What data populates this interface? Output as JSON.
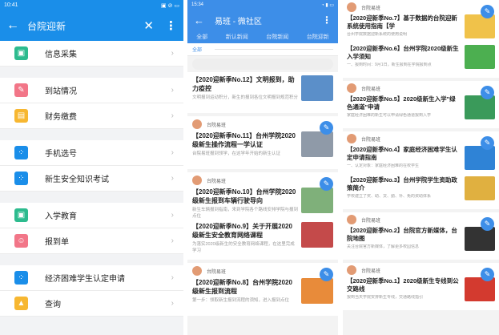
{
  "panel1": {
    "status_time": "10:41",
    "status_right": "▣ ⊘ ▭",
    "title": "台院迎新",
    "menu": [
      {
        "label": "信息采集",
        "icon": "image-icon",
        "glyph": "▣",
        "color": "#2dbb8e"
      },
      {
        "label": "到站情况",
        "icon": "edit-icon",
        "glyph": "✎",
        "color": "#f27688"
      },
      {
        "label": "财务缴费",
        "icon": "wallet-icon",
        "glyph": "▤",
        "color": "#f7b731"
      },
      {
        "label": "手机选号",
        "icon": "grid-icon",
        "glyph": "⁘",
        "color": "#1a8ee9"
      },
      {
        "label": "新生安全知识考试",
        "icon": "grid-icon",
        "glyph": "⁘",
        "color": "#1a8ee9"
      },
      {
        "label": "入学教育",
        "icon": "image-icon",
        "glyph": "▣",
        "color": "#2dbb8e"
      },
      {
        "label": "报到单",
        "icon": "person-icon",
        "glyph": "☺",
        "color": "#f27688"
      },
      {
        "label": "经济困难学生认定申请",
        "icon": "grid-icon",
        "glyph": "⁘",
        "color": "#1a8ee9"
      },
      {
        "label": "查询",
        "icon": "graduation-cap-icon",
        "glyph": "▲",
        "color": "#f7b731"
      }
    ]
  },
  "panel2": {
    "status_time": "15:34",
    "status_right": "◔ ▮ ▭",
    "title": "易班 - 微社区",
    "tabs": [
      "全部",
      "新认新闻",
      "台院新闻",
      "台院迎新"
    ],
    "subtab_active": "全部",
    "cards": [
      {
        "articles": [
          {
            "title": "【2020迎新季No.12】文明报到，助力疫控",
            "desc": "文明报到运动积分，新生的报到各位文明报到规范积分",
            "thumb": "#5b8fc9"
          }
        ]
      },
      {
        "account": "台院易班",
        "articles": [
          {
            "title": "【2020迎新季No.11】台州学院2020级新生操作流程一学认证",
            "desc": "台院易班报到领学，在这学年开始的新生认证",
            "thumb": "#8f9aa8"
          }
        ]
      },
      {
        "account": "台院易班",
        "articles": [
          {
            "title": "【2020迎新季No.10】台州学院2020级新生报到车辆行驶导向",
            "desc": "新生车辆报到指南，来到学院各个路线安排学院与报到点位",
            "thumb": "#7fb07a"
          },
          {
            "title": "【2020迎新季No.9】关于开展2020级新生安全教育网络课程",
            "desc": "为落实2020级新生的安全教育网络课程，在这里完成学习",
            "thumb": "#c44a4a"
          }
        ]
      },
      {
        "account": "台院易班",
        "articles": [
          {
            "title": "【2020迎新季No.8】台州学院2020级新生报到流程",
            "desc": "第一步：领取新生报到流程的须知，进入报到点位",
            "thumb": "#e88b3a"
          }
        ]
      }
    ]
  },
  "panel3": {
    "cards": [
      {
        "account": "台院易班",
        "articles": [
          {
            "title": "【2020迎新季No.7】基于数据的台院迎新系统使用指南【学",
            "desc": "台州学院数据迎新系统的使用说明",
            "thumb": "#f0c24a"
          },
          {
            "title": "【2020迎新季No.6】台州学院2020级新生入学须知",
            "desc": "一、报到时间：9月1日，新生报到在学院报到点",
            "thumb": "#4caf50"
          }
        ]
      },
      {
        "account": "台院易班",
        "articles": [
          {
            "title": "【2020迎新季No.5】2020级新生入学\"绿色通道\"申请",
            "desc": "家庭经济困难的新生可以申请绿色通道报到入学",
            "thumb": "#3a9a5a"
          }
        ]
      },
      {
        "account": "台院易班",
        "articles": [
          {
            "title": "【2020迎新季No.4】家庭经济困难学生认定申请指南",
            "desc": "一、认定对象：家庭经济困难的在校学生",
            "thumb": "#2f83d6"
          },
          {
            "title": "【2020迎新季No.3】台州学院学生资助政策简介",
            "desc": "学校建立了奖、助、贷、勤、补、免的资助体系",
            "thumb": "#e0b040"
          }
        ]
      },
      {
        "account": "台院易班",
        "articles": [
          {
            "title": "【2020迎新季No.2】台院官方新媒体，台院地图",
            "desc": "关注台院官方新媒体，了解更多校园信息",
            "thumb": "#333333"
          }
        ]
      },
      {
        "account": "台院易班",
        "articles": [
          {
            "title": "【2020迎新季No.1】2020级新生专线到公交路线",
            "desc": "报到当天学院安排新生专线，交通路线指引",
            "thumb": "#d33a2f"
          }
        ]
      }
    ]
  }
}
